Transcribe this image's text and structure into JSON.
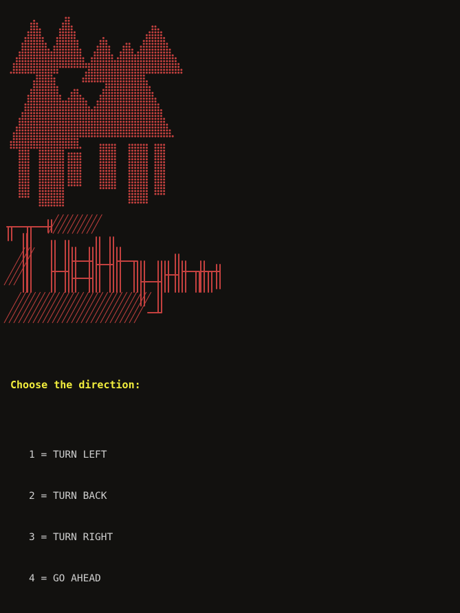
{
  "prompt": "Choose the direction:",
  "options": [
    {
      "key": "1",
      "sep": " = ",
      "label": "TURN LEFT"
    },
    {
      "key": "2",
      "sep": " = ",
      "label": "TURN BACK"
    },
    {
      "key": "3",
      "sep": " = ",
      "label": "TURN RIGHT"
    },
    {
      "key": "4",
      "sep": " = ",
      "label": "GO AHEAD"
    }
  ],
  "colors": {
    "background": "#12110f",
    "art": "#c4413f",
    "prompt": "#f2ee3d",
    "text": "#cfcfcf"
  },
  "art": {
    "trees_icon": "dotted-pine-trees-icon",
    "logo_icon": "ascii-title-logo"
  }
}
